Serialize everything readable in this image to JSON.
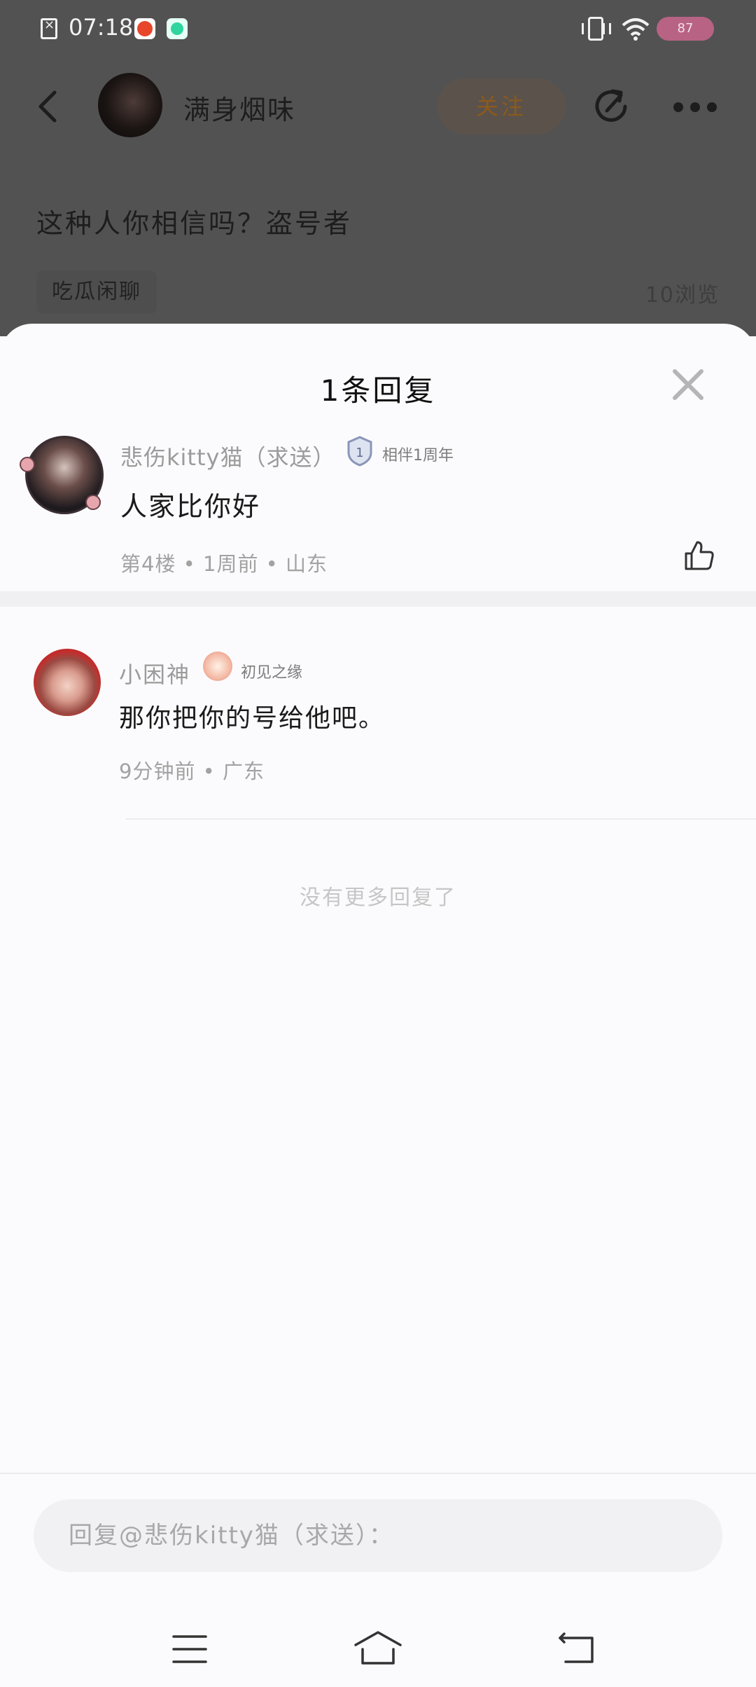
{
  "status_bar": {
    "time": "07:18",
    "battery_level": "87",
    "icons": [
      "sim-error-icon",
      "app-notification-icon",
      "app-notification-icon",
      "vibrate-icon",
      "wifi-icon",
      "battery-icon"
    ]
  },
  "post_header": {
    "author_name": "满身烟味",
    "follow_label": "关注",
    "post_title": "这种人你相信吗？盗号者",
    "tag": "吃瓜闲聊",
    "views": "10浏览",
    "icons": [
      "back-arrow-icon",
      "share-icon",
      "more-icon"
    ]
  },
  "sheet": {
    "title": "1条回复",
    "close_icon": "close-icon",
    "main_comment": {
      "author": "悲伤kitty猫（求送）",
      "badge": "相伴1周年",
      "text": "人家比你好",
      "meta": "第4楼 • 1周前 • 山东",
      "like_icon": "thumbs-up-icon"
    },
    "reply": {
      "author": "小困神",
      "badge": "初见之缘",
      "text": "那你把你的号给他吧。",
      "meta": "9分钟前 • 广东"
    },
    "no_more": "没有更多回复了",
    "reply_input": {
      "placeholder": "回复@悲伤kitty猫（求送）：",
      "value": ""
    }
  },
  "nav_bar": {
    "icons": [
      "menu-icon",
      "home-icon",
      "back-icon"
    ]
  },
  "colors": {
    "overlay": "#525252",
    "sheet_bg": "#fbfbfd",
    "follow_text": "#8a5a1e",
    "meta_text": "#a2a2a2",
    "battery_pill": "#b86384"
  }
}
